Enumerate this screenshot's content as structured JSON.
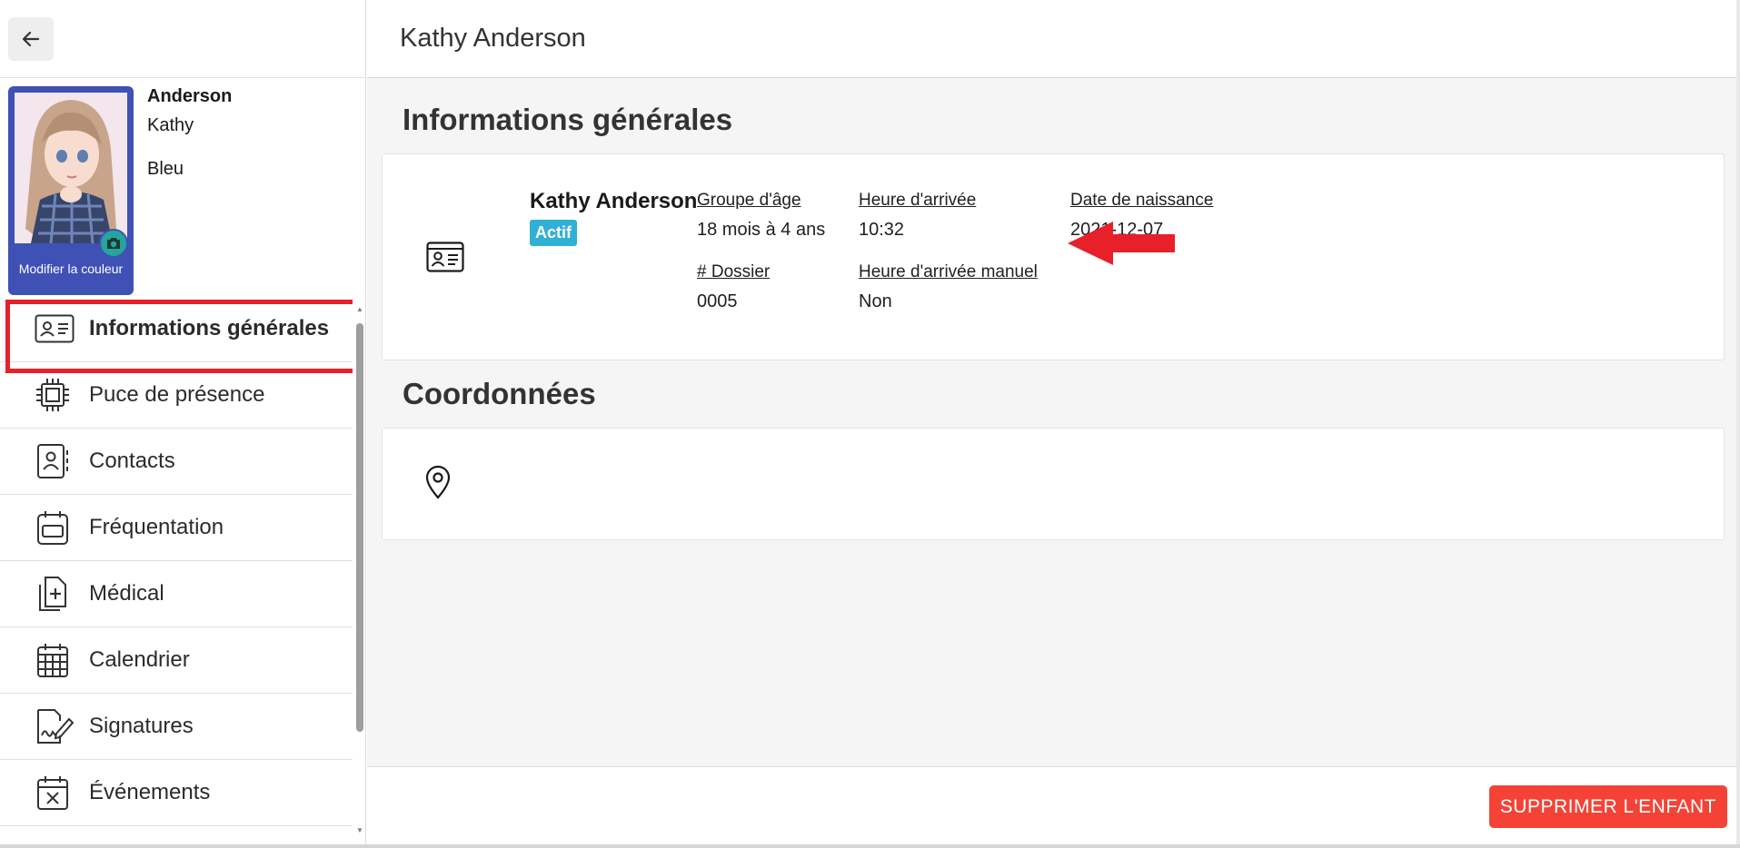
{
  "header": {
    "title": "Kathy Anderson"
  },
  "profile": {
    "last_name": "Anderson",
    "first_name": "Kathy",
    "color": "Bleu",
    "color_hex": "#3f51b5",
    "modify_color_label": "Modifier la couleur"
  },
  "sidebar": {
    "items": [
      {
        "label": "Informations générales",
        "icon": "id-card-icon",
        "active": true
      },
      {
        "label": "Puce de présence",
        "icon": "chip-icon"
      },
      {
        "label": "Contacts",
        "icon": "contact-book-icon"
      },
      {
        "label": "Fréquentation",
        "icon": "attendance-calendar-icon"
      },
      {
        "label": "Médical",
        "icon": "medical-file-icon"
      },
      {
        "label": "Calendrier",
        "icon": "calendar-grid-icon"
      },
      {
        "label": "Signatures",
        "icon": "signature-icon"
      },
      {
        "label": "Événements",
        "icon": "calendar-x-icon"
      }
    ]
  },
  "general_info": {
    "section_title": "Informations générales",
    "child_name": "Kathy Anderson",
    "status": "Actif",
    "status_color": "#31b0d5",
    "fields": {
      "age_group": {
        "label": "Groupe d'âge",
        "value": "18 mois à 4 ans"
      },
      "arrival_time": {
        "label": "Heure d'arrivée",
        "value": "10:32"
      },
      "birth_date": {
        "label": "Date de naissance",
        "value": "2021-12-07"
      },
      "file_number": {
        "label": "# Dossier",
        "value": "0005"
      },
      "manual_arrival": {
        "label": "Heure d'arrivée manuel",
        "value": "Non"
      }
    }
  },
  "coordinates": {
    "section_title": "Coordonnées"
  },
  "footer": {
    "delete_label": "SUPPRIMER L'ENFANT",
    "delete_color": "#f44336"
  },
  "annotations": {
    "highlight_color": "#e8202a"
  }
}
